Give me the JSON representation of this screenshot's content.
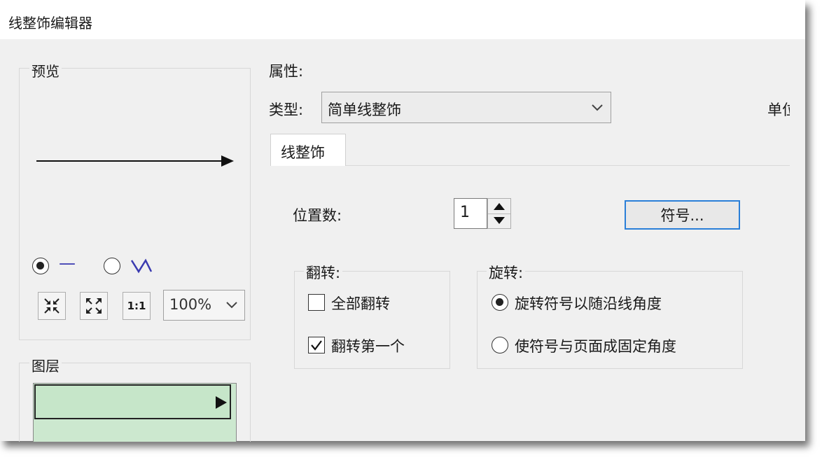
{
  "window": {
    "title": "线整饰编辑器"
  },
  "preview": {
    "legend": "预览",
    "mode_line_symbol": "—",
    "mode_zigzag_symbol": "\\/\\",
    "zoom_value": "100%",
    "one_to_one_label": "1:1"
  },
  "layers": {
    "legend": "图层"
  },
  "properties": {
    "heading": "属性:",
    "type_label": "类型:",
    "type_value": "简单线整饰",
    "unit_label_partial": "单位"
  },
  "tab": {
    "label": "线整饰"
  },
  "position_count": {
    "label": "位置数:",
    "value": "1"
  },
  "symbol_button": {
    "label": "符号..."
  },
  "flip": {
    "legend": "翻转:",
    "all_label": "全部翻转",
    "first_label": "翻转第一个",
    "all_checked": false,
    "first_checked": true
  },
  "rotate": {
    "legend": "旋转:",
    "follow_line_label": "旋转符号以随沿线角度",
    "fixed_label": "使符号与页面成固定角度"
  }
}
